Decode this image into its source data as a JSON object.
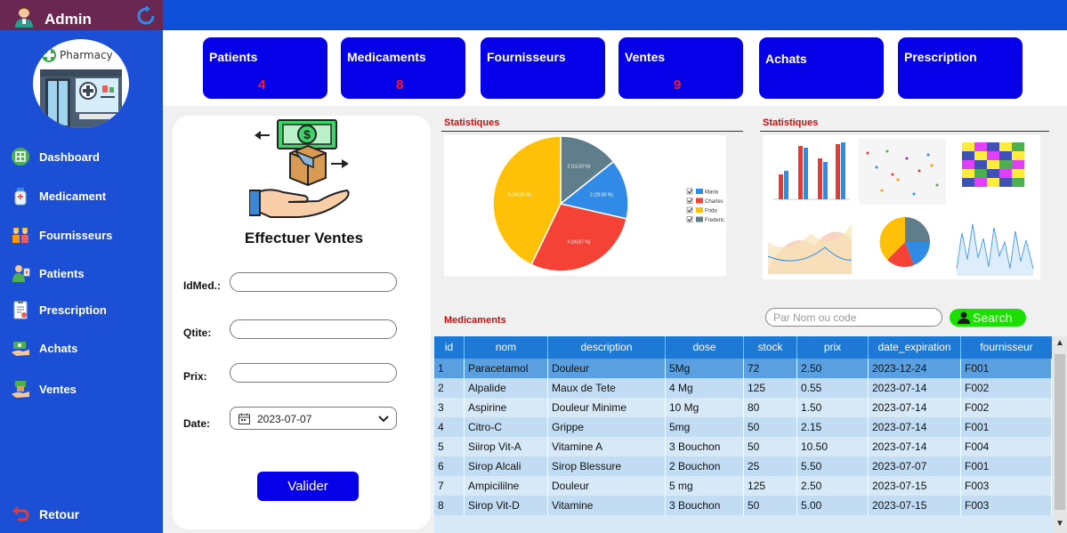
{
  "sidebar": {
    "title": "Admin",
    "logo_text": "Pharmacy",
    "items": [
      {
        "label": "Dashboard",
        "icon": "dashboard-icon"
      },
      {
        "label": "Medicament",
        "icon": "medicine-icon"
      },
      {
        "label": "Fournisseurs",
        "icon": "suppliers-icon"
      },
      {
        "label": "Patients",
        "icon": "patient-icon"
      },
      {
        "label": "Prescription",
        "icon": "prescription-icon"
      },
      {
        "label": "Achats",
        "icon": "purchases-icon"
      },
      {
        "label": "Ventes",
        "icon": "sales-icon"
      }
    ],
    "back_label": "Retour"
  },
  "cards": [
    {
      "title": "Patients",
      "value": "4"
    },
    {
      "title": "Medicaments",
      "value": "8"
    },
    {
      "title": "Fournisseurs",
      "value": ""
    },
    {
      "title": "Ventes",
      "value": "9"
    },
    {
      "title": "Achats",
      "value": ""
    },
    {
      "title": "Prescription",
      "value": ""
    }
  ],
  "form": {
    "title": "Effectuer Ventes",
    "labels": {
      "idmed": "IdMed.:",
      "qtite": "Qtite:",
      "prix": "Prix:",
      "date": "Date:"
    },
    "values": {
      "idmed": "",
      "qtite": "",
      "prix": "",
      "date": "2023-07-07"
    },
    "submit_label": "Valider"
  },
  "stats": {
    "title_left": "Statistiques",
    "title_right": "Statistiques"
  },
  "chart_data": {
    "type": "pie",
    "title": "",
    "slices": [
      {
        "label": "Maria",
        "value": 2,
        "text": "2 (20,00 %)",
        "color": "#2f8be6"
      },
      {
        "label": "Charles",
        "value": 4,
        "text": "4 (26,67 %)",
        "color": "#f44336"
      },
      {
        "label": "Frida",
        "value": 6,
        "text": "6 (40,00 %)",
        "color": "#ffc107"
      },
      {
        "label": "Frederic",
        "value": 2,
        "text": "2 (13,33 %)",
        "color": "#607d8b"
      }
    ],
    "legend": "right"
  },
  "medicaments": {
    "title": "Medicaments",
    "search_placeholder": "Par Nom ou code",
    "search_label": "Search",
    "columns": [
      "id",
      "nom",
      "description",
      "dose",
      "stock",
      "prix",
      "date_expiration",
      "fournisseur"
    ],
    "rows": [
      [
        "1",
        "Paracetamol",
        "Douleur",
        "5Mg",
        "72",
        "2.50",
        "2023-12-24",
        "F001"
      ],
      [
        "2",
        "Alpalide",
        "Maux de Tete",
        "4 Mg",
        "125",
        "0.55",
        "2023-07-14",
        "F002"
      ],
      [
        "3",
        "Aspirine",
        "Douleur Minime",
        "10 Mg",
        "80",
        "1.50",
        "2023-07-14",
        "F002"
      ],
      [
        "4",
        "Citro-C",
        "Grippe",
        "5mg",
        "50",
        "2.15",
        "2023-07-14",
        "F001"
      ],
      [
        "5",
        "Siirop Vit-A",
        "Vitamine A",
        "3 Bouchon",
        "50",
        "10.50",
        "2023-07-14",
        "F004"
      ],
      [
        "6",
        "Sirop Alcali",
        "Sirop Blessure",
        "2 Bouchon",
        "25",
        "5.50",
        "2023-07-07",
        "F001"
      ],
      [
        "7",
        "Ampicililne",
        "Douleur",
        "5 mg",
        "125",
        "2.50",
        "2023-07-15",
        "F003"
      ],
      [
        "8",
        "Sirop Vit-D",
        "Vitamine",
        "3 Bouchon",
        "50",
        "5.00",
        "2023-07-15",
        "F003"
      ]
    ]
  },
  "colors": {
    "sidebar": "#1a4fd6",
    "sidebar_header": "#6a2752",
    "card": "#0600e8",
    "card_value": "#ff1a1a",
    "table_header": "#1d78d6",
    "row_selected": "#5aa0e0",
    "row_alt": "#c2ddf3",
    "row": "#d7e9f7",
    "search_button": "#19e000"
  }
}
